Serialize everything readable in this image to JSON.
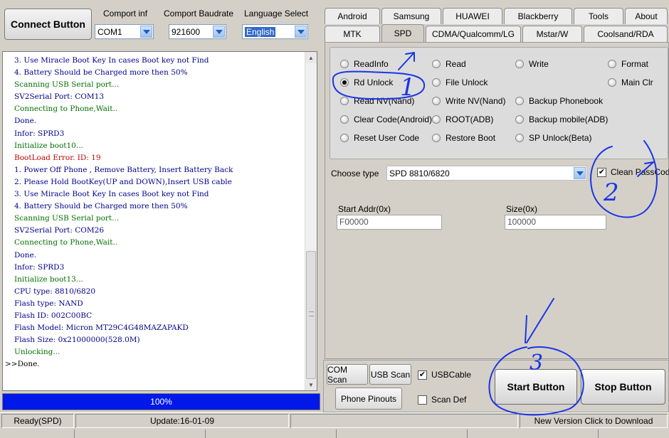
{
  "toolbar": {
    "connect_label": "Connect Button",
    "comport_inf_label": "Comport inf",
    "comport_inf_value": "COM1",
    "baudrate_label": "Comport Baudrate",
    "baudrate_value": "921600",
    "language_label": "Language Select",
    "language_value": "English"
  },
  "log": {
    "lines": [
      {
        "text": "3. Use Miracle Boot Key In cases Boot key not Find",
        "color": "blue"
      },
      {
        "text": "4. Battery Should be Charged more then 50%",
        "color": "blue"
      },
      {
        "text": "Scanning USB Serial port...",
        "color": "green"
      },
      {
        "text": "SV2Serial Port: COM13",
        "color": "blue"
      },
      {
        "text": "Connecting to Phone,Wait..",
        "color": "green"
      },
      {
        "text": "Done.",
        "color": "blue"
      },
      {
        "text": "Infor: SPRD3",
        "color": "blue"
      },
      {
        "text": "Initialize boot10...",
        "color": "green"
      },
      {
        "text": "BootLoad Error. ID: 19",
        "color": "red"
      },
      {
        "text": "1. Power Off Phone , Remove Battery, Insert Battery Back",
        "color": "blue"
      },
      {
        "text": "2. Please Hold BootKey(UP and DOWN),Insert USB cable",
        "color": "blue"
      },
      {
        "text": "3. Use Miracle Boot Key In cases Boot key not Find",
        "color": "blue"
      },
      {
        "text": "4. Battery Should be Charged more then 50%",
        "color": "blue"
      },
      {
        "text": "Scanning USB Serial port...",
        "color": "green"
      },
      {
        "text": "SV2Serial Port: COM26",
        "color": "blue"
      },
      {
        "text": "Connecting to Phone,Wait..",
        "color": "green"
      },
      {
        "text": "Done.",
        "color": "blue"
      },
      {
        "text": "Infor: SPRD3",
        "color": "blue"
      },
      {
        "text": "Initialize boot13...",
        "color": "green"
      },
      {
        "text": "CPU    type: 8810/6820",
        "color": "blue"
      },
      {
        "text": "Flash  type: NAND",
        "color": "blue"
      },
      {
        "text": "Flash    ID: 002C00BC",
        "color": "blue"
      },
      {
        "text": "Flash Model: Micron MT29C4G48MAZAPAKD",
        "color": "blue"
      },
      {
        "text": "Flash  Size: 0x21000000(528.0M)",
        "color": "blue"
      },
      {
        "text": "Unlocking...",
        "color": "green"
      },
      {
        "text": ">>Done.",
        "color": "black"
      }
    ]
  },
  "progress": {
    "label": "100%",
    "value": 1.0
  },
  "tabs_row1": [
    "Android",
    "Samsung",
    "HUAWEI",
    "Blackberry",
    "Tools",
    "About"
  ],
  "tabs_row2": [
    "MTK",
    "SPD",
    "CDMA/Qualcomm/LG",
    "Mstar/W",
    "Coolsand/RDA"
  ],
  "active_tab": "SPD",
  "options": [
    {
      "label": "ReadInfo",
      "checked": false
    },
    {
      "label": "Read",
      "checked": false
    },
    {
      "label": "Write",
      "checked": false
    },
    {
      "label": "Format",
      "checked": false
    },
    {
      "label": "Rd Unlock",
      "checked": true
    },
    {
      "label": "File Unlock",
      "checked": false
    },
    {
      "label": "Main Clr",
      "checked": false
    },
    {
      "label": "Read NV(Nand)",
      "checked": false
    },
    {
      "label": "Write NV(Nand)",
      "checked": false
    },
    {
      "label": "Backup Phonebook",
      "checked": false
    },
    {
      "label": "Clear Code(Android)",
      "checked": false
    },
    {
      "label": "ROOT(ADB)",
      "checked": false
    },
    {
      "label": "Backup mobile(ADB)",
      "checked": false
    },
    {
      "label": "Reset User Code",
      "checked": false
    },
    {
      "label": "Restore Boot",
      "checked": false
    },
    {
      "label": "SP Unlock(Beta)",
      "checked": false
    }
  ],
  "choose_type": {
    "label": "Choose  type",
    "value": "SPD 8810/6820"
  },
  "clean_pass_code": {
    "label": "Clean PassCode",
    "checked": true
  },
  "start_addr": {
    "label": "Start Addr(0x)",
    "value": "F00000"
  },
  "size": {
    "label": "Size(0x)",
    "value": "100000"
  },
  "bottom": {
    "com_scan": "COM Scan",
    "usb_scan": "USB Scan",
    "usb_cable": {
      "label": "USBCable",
      "checked": true
    },
    "phone_pinouts": "Phone Pinouts",
    "scan_def": {
      "label": "Scan Def",
      "checked": false
    },
    "start_button": "Start Button",
    "stop_button": "Stop Button"
  },
  "status": {
    "state": "Ready(SPD)",
    "update": "Update:16-01-09",
    "new_version": "New Version Click to Download"
  },
  "annotations": {
    "mark1": "1",
    "mark2": "2",
    "mark3": "3",
    "ink_color": "#1a35e6"
  },
  "colors": {
    "log_blue": "#00008b",
    "log_green": "#007000",
    "log_red": "#c00000",
    "progress": "#0018e8"
  }
}
